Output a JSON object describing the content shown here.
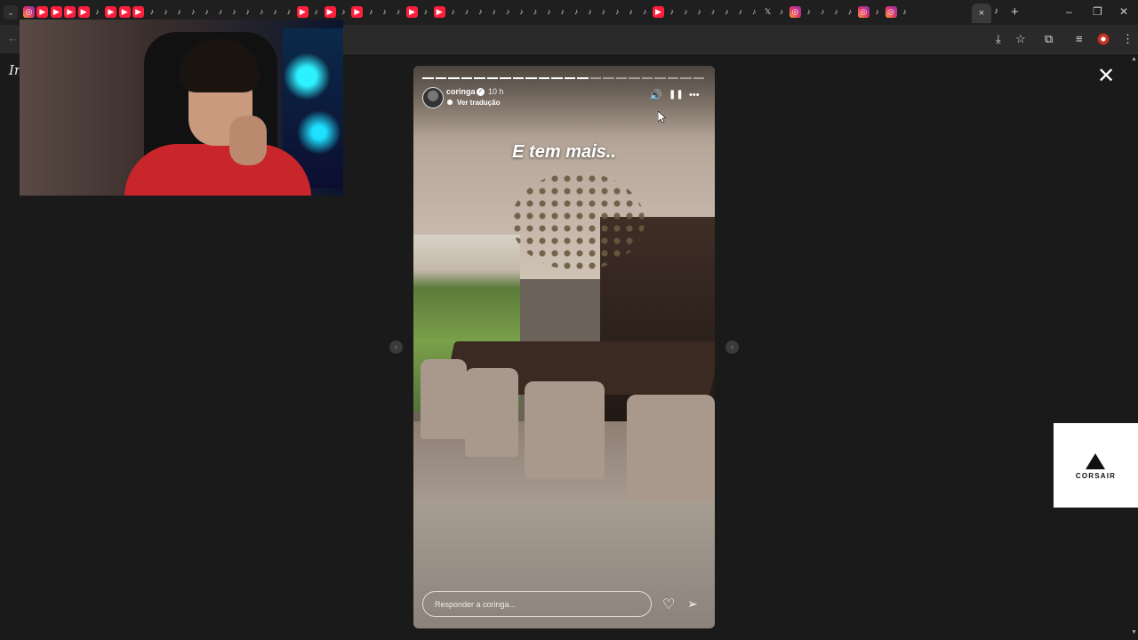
{
  "browser": {
    "tab_search_icon": "chevron-down-icon",
    "tab_icon_sequence": [
      "ig",
      "yt",
      "yt",
      "yt",
      "yt",
      "tk",
      "yt",
      "yt",
      "yt",
      "tk",
      "tk",
      "tk",
      "tk",
      "tk",
      "tk",
      "tk",
      "tk",
      "tk",
      "tk",
      "tk",
      "yt",
      "tk",
      "yt",
      "tk",
      "yt",
      "tk",
      "tk",
      "tk",
      "yt",
      "tk",
      "yt",
      "tk",
      "tk",
      "tk",
      "tk",
      "tk",
      "tk",
      "tk",
      "tk",
      "tk",
      "tk",
      "tk",
      "tk",
      "tk",
      "tk",
      "tk",
      "yt",
      "tk",
      "tk",
      "tk",
      "tk",
      "tk",
      "tk",
      "tk",
      "x",
      "tk",
      "ig",
      "tk",
      "tk",
      "tk",
      "tk",
      "ig",
      "tk",
      "ig",
      "tk"
    ],
    "active_tab_close": "×",
    "new_tab": "+",
    "window_controls": [
      "–",
      "❐",
      "✕"
    ],
    "toolbar_icons": [
      "install-icon",
      "star-icon",
      "extensions-icon",
      "media-icon",
      "profile-avatar",
      "menu-icon"
    ]
  },
  "webcam": {
    "label": "streamer-webcam"
  },
  "left_logo": "In",
  "story": {
    "username": "coringa",
    "time": "10 h",
    "translate_label": "Ver tradução",
    "caption": "E tem mais..",
    "progress_total": 22,
    "progress_done": 13,
    "reply_placeholder": "Responder a coringa...",
    "controls": {
      "sound": "🔊",
      "pause": "❚❚",
      "more": "•••"
    }
  },
  "close_label": "✕",
  "nav": {
    "prev": "‹",
    "next": "›"
  },
  "ad": {
    "brand": "CORSAIR"
  }
}
